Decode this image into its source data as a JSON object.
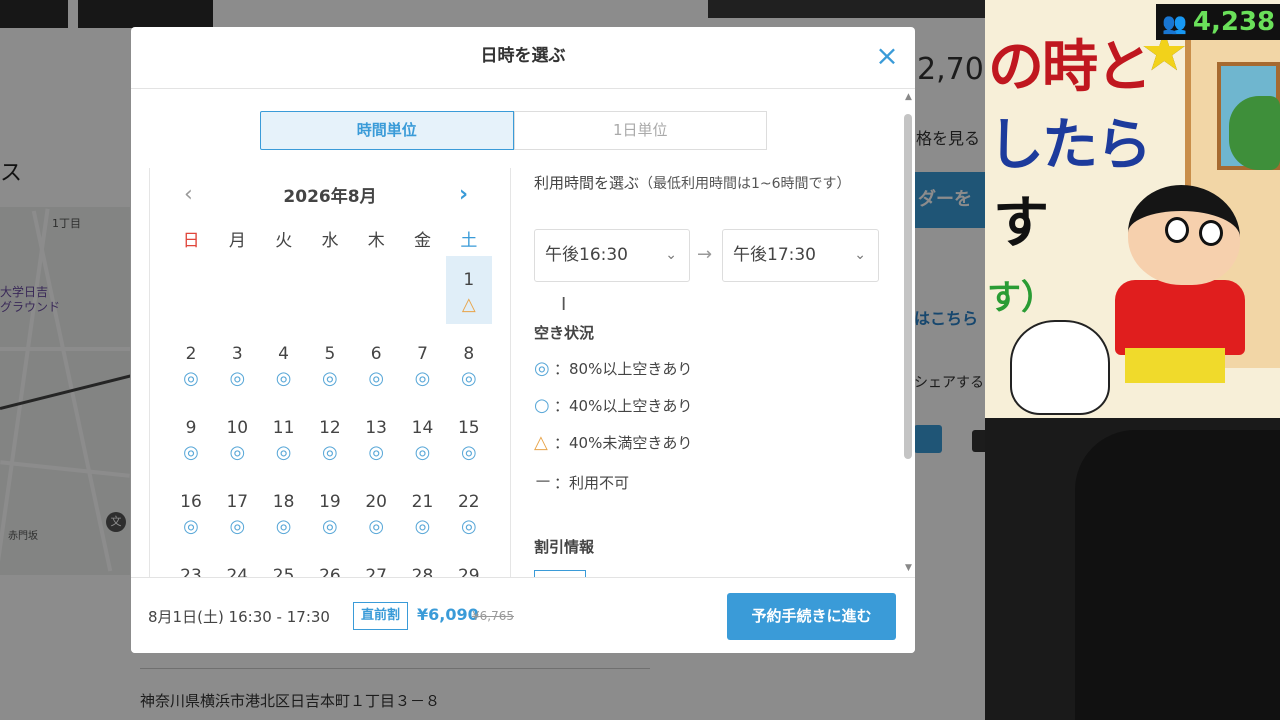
{
  "background": {
    "side_heading": "ス",
    "map": {
      "label_area": "1丁目",
      "label_ground": "大学日吉\nグラウンド",
      "label_street": "赤門坂",
      "school_icon": "文"
    },
    "price_fragment": "2,70",
    "see_price_fragment": "格を見る",
    "button_fragment": "ダーを見",
    "link_fragment": "はこちら",
    "share_fragment": "シェアする",
    "address": "神奈川県横浜市港北区日吉本町１丁目３－８"
  },
  "stream_overlay": {
    "viewer_icon": "viewers-icon",
    "viewer_count": "4,238",
    "anime_text_line1": "の時と",
    "anime_text_line2": "したら",
    "anime_text_line3": "す",
    "anime_text_line4": "す）"
  },
  "modal": {
    "title": "日時を選ぶ",
    "close_icon": "close-icon",
    "tabs": [
      {
        "label": "時間単位",
        "active": true
      },
      {
        "label": "1日単位",
        "active": false
      }
    ],
    "calendar": {
      "month": "2026年8月",
      "prev": "‹",
      "next": "›",
      "weekdays": [
        "日",
        "月",
        "火",
        "水",
        "木",
        "金",
        "土"
      ],
      "selected_day": "1",
      "days": [
        {
          "day": "1",
          "col": 6,
          "row": 0,
          "mark": "△"
        },
        {
          "day": "2",
          "col": 0,
          "row": 1,
          "mark": "◎"
        },
        {
          "day": "3",
          "col": 1,
          "row": 1,
          "mark": "◎"
        },
        {
          "day": "4",
          "col": 2,
          "row": 1,
          "mark": "◎"
        },
        {
          "day": "5",
          "col": 3,
          "row": 1,
          "mark": "◎"
        },
        {
          "day": "6",
          "col": 4,
          "row": 1,
          "mark": "◎"
        },
        {
          "day": "7",
          "col": 5,
          "row": 1,
          "mark": "◎"
        },
        {
          "day": "8",
          "col": 6,
          "row": 1,
          "mark": "◎"
        },
        {
          "day": "9",
          "col": 0,
          "row": 2,
          "mark": "◎"
        },
        {
          "day": "10",
          "col": 1,
          "row": 2,
          "mark": "◎"
        },
        {
          "day": "11",
          "col": 2,
          "row": 2,
          "mark": "◎"
        },
        {
          "day": "12",
          "col": 3,
          "row": 2,
          "mark": "◎"
        },
        {
          "day": "13",
          "col": 4,
          "row": 2,
          "mark": "◎"
        },
        {
          "day": "14",
          "col": 5,
          "row": 2,
          "mark": "◎"
        },
        {
          "day": "15",
          "col": 6,
          "row": 2,
          "mark": "◎"
        },
        {
          "day": "16",
          "col": 0,
          "row": 3,
          "mark": "◎"
        },
        {
          "day": "17",
          "col": 1,
          "row": 3,
          "mark": "◎"
        },
        {
          "day": "18",
          "col": 2,
          "row": 3,
          "mark": "◎"
        },
        {
          "day": "19",
          "col": 3,
          "row": 3,
          "mark": "◎"
        },
        {
          "day": "20",
          "col": 4,
          "row": 3,
          "mark": "◎"
        },
        {
          "day": "21",
          "col": 5,
          "row": 3,
          "mark": "◎"
        },
        {
          "day": "22",
          "col": 6,
          "row": 3,
          "mark": "◎"
        },
        {
          "day": "23",
          "col": 0,
          "row": 4,
          "mark": ""
        },
        {
          "day": "24",
          "col": 1,
          "row": 4,
          "mark": ""
        },
        {
          "day": "25",
          "col": 2,
          "row": 4,
          "mark": ""
        },
        {
          "day": "26",
          "col": 3,
          "row": 4,
          "mark": ""
        },
        {
          "day": "27",
          "col": 4,
          "row": 4,
          "mark": ""
        },
        {
          "day": "28",
          "col": 5,
          "row": 4,
          "mark": ""
        },
        {
          "day": "29",
          "col": 6,
          "row": 4,
          "mark": ""
        }
      ]
    },
    "time": {
      "heading": "利用時間を選ぶ",
      "heading_note": "（最低利用時間は1~6時間です）",
      "from": "午後16:30",
      "to": "午後17:30",
      "arrow": "→"
    },
    "availability": {
      "heading": "空き状況",
      "legend": [
        {
          "mark": "◎",
          "text": "：80%以上空きあり",
          "color": "#5aa8d8"
        },
        {
          "mark": "○",
          "text": "：40%以上空きあり",
          "color": "#5aa8d8"
        },
        {
          "mark": "△",
          "text": "：40%未満空きあり",
          "color": "#e8a44a"
        },
        {
          "mark": "－",
          "text": "：利用不可",
          "color": "#555555"
        }
      ]
    },
    "discount": {
      "heading": "割引情報"
    },
    "footer": {
      "selection": "8月1日(土) 16:30 - 17:30",
      "badge": "直前割",
      "price": "¥6,090",
      "original_price": "¥6,765",
      "button": "予約手続きに進む"
    }
  },
  "colors": {
    "accent": "#3a9bd8",
    "sunday": "#e0453a",
    "triangle": "#e8a44a"
  }
}
